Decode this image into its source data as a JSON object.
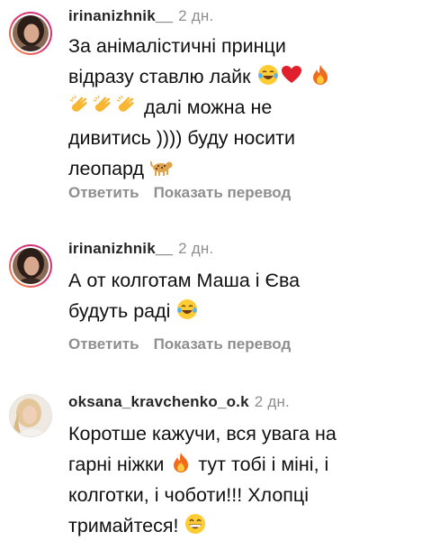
{
  "comments": [
    {
      "username": "irinanizhnik__",
      "time": "2 дн.",
      "text_lines": [
        "За анімалістичні принци",
        "відразу ставлю лайк",
        "далі можна не",
        "дивитись )))) буду носити",
        "леопард"
      ],
      "reply_label": "Ответить",
      "translate_label": "Показать перевод",
      "avatar_icon": "profile-photo-woman-dark-hair"
    },
    {
      "username": "irinanizhnik__",
      "time": "2 дн.",
      "text_lines": [
        "А от колготам Маша і Єва",
        "будуть раді"
      ],
      "reply_label": "Ответить",
      "translate_label": "Показать перевод",
      "avatar_icon": "profile-photo-woman-dark-hair"
    },
    {
      "username": "oksana_kravchenko_o.k",
      "time": "2 дн.",
      "text_lines": [
        "Коротше кажучи, вся увага на",
        "гарні ніжки",
        "тут тобі і міні, і",
        "колготки, і чоботи!!! Хлопці",
        "тримайтеся!"
      ],
      "avatar_icon": "profile-photo-woman-blonde"
    }
  ],
  "emoji_names": [
    "tears-of-joy-emoji",
    "red-heart-emoji",
    "fire-emoji",
    "clapping-hands-emoji",
    "leopard-emoji",
    "grinning-face-emoji"
  ],
  "colors": {
    "text": "#111111",
    "username": "#262626",
    "secondary": "#8e8e8e",
    "story_ring_start": "#f9a03f",
    "story_ring_end": "#c13584"
  }
}
